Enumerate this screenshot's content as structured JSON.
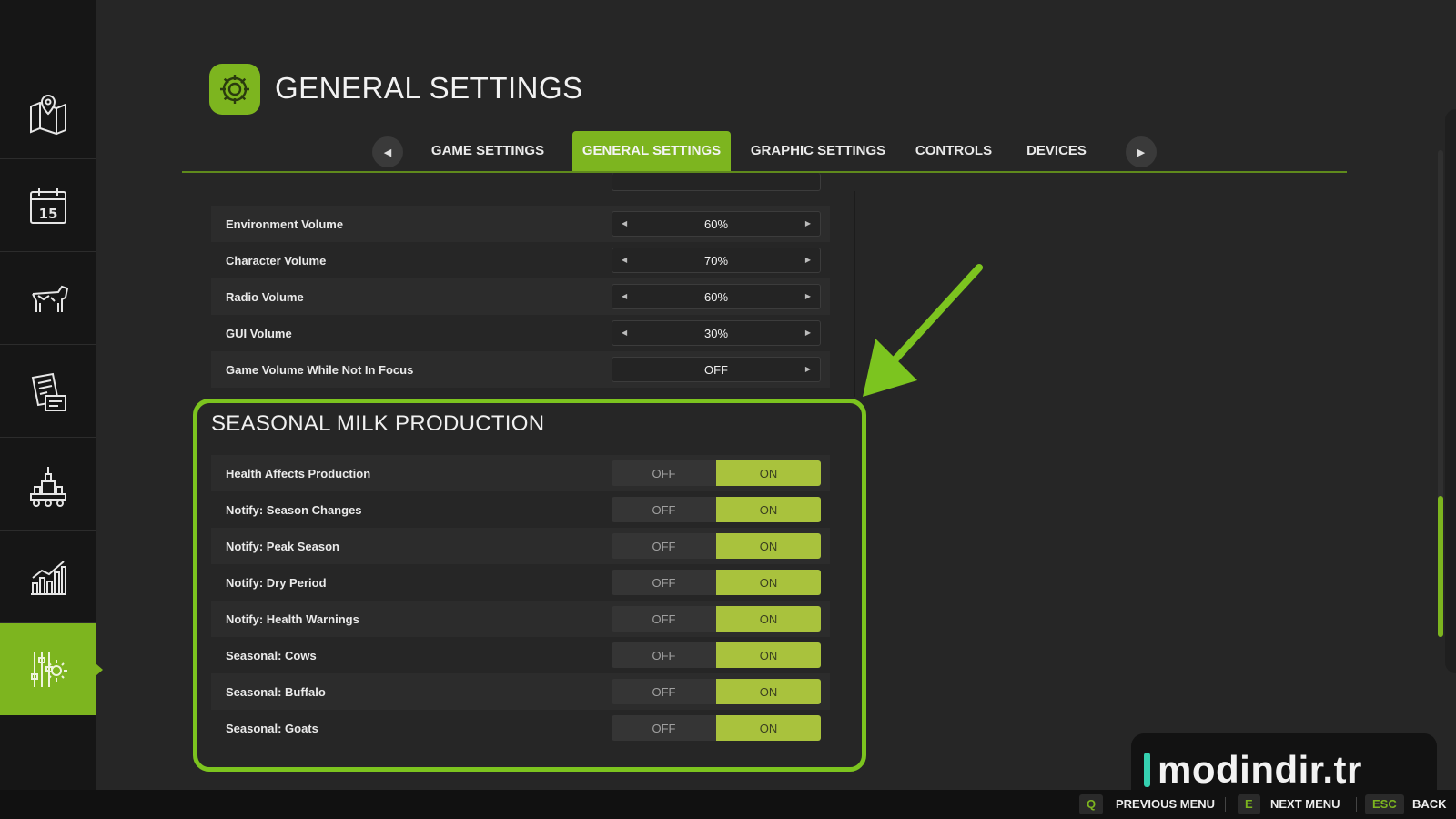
{
  "header": {
    "title": "GENERAL SETTINGS"
  },
  "sidebar": {
    "items": [
      {
        "icon": "map-icon"
      },
      {
        "icon": "calendar-icon",
        "label": "15"
      },
      {
        "icon": "cow-icon"
      },
      {
        "icon": "contracts-icon"
      },
      {
        "icon": "production-icon"
      },
      {
        "icon": "statistics-icon"
      },
      {
        "icon": "settings-sliders-icon",
        "active": true
      }
    ]
  },
  "tabs": {
    "items": [
      {
        "label": "GAME SETTINGS"
      },
      {
        "label": "GENERAL SETTINGS",
        "active": true
      },
      {
        "label": "GRAPHIC SETTINGS"
      },
      {
        "label": "CONTROLS"
      },
      {
        "label": "DEVICES"
      }
    ]
  },
  "audio": {
    "rows": [
      {
        "label": "Environment Volume",
        "value": "60%"
      },
      {
        "label": "Character Volume",
        "value": "70%"
      },
      {
        "label": "Radio Volume",
        "value": "60%"
      },
      {
        "label": "GUI Volume",
        "value": "30%"
      },
      {
        "label": "Game Volume While Not In Focus",
        "value": "OFF"
      }
    ]
  },
  "seasonal": {
    "title": "SEASONAL MILK PRODUCTION",
    "off_label": "OFF",
    "on_label": "ON",
    "rows": [
      {
        "label": "Health Affects Production",
        "state": "ON"
      },
      {
        "label": "Notify: Season Changes",
        "state": "ON"
      },
      {
        "label": "Notify: Peak Season",
        "state": "ON"
      },
      {
        "label": "Notify: Dry Period",
        "state": "ON"
      },
      {
        "label": "Notify: Health Warnings",
        "state": "ON"
      },
      {
        "label": "Seasonal: Cows",
        "state": "ON"
      },
      {
        "label": "Seasonal: Buffalo",
        "state": "ON"
      },
      {
        "label": "Seasonal: Goats",
        "state": "ON"
      }
    ]
  },
  "watermark": {
    "text": "modindir.tr"
  },
  "bottom_bar": {
    "prev_key": "Q",
    "prev_label": "PREVIOUS MENU",
    "next_key": "E",
    "next_label": "NEXT MENU",
    "back_key": "ESC",
    "back_label": "BACK"
  },
  "colors": {
    "accent": "#7db51f",
    "toggle_on": "#a9c23d",
    "highlight": "#7cc41f",
    "background": "#262626"
  }
}
